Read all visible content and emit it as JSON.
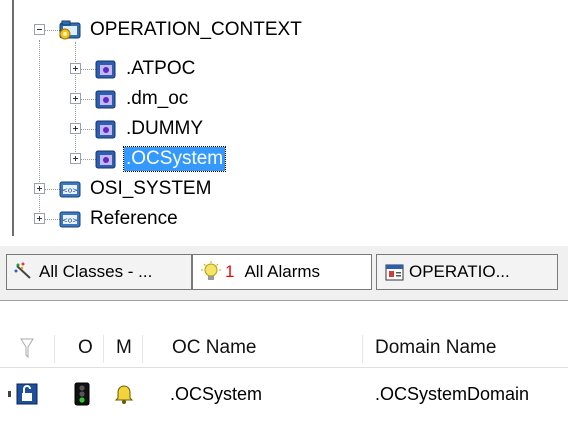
{
  "tree": {
    "root": {
      "label": "OPERATION_CONTEXT",
      "icon": "operation-context-folder-icon"
    },
    "children": [
      {
        "label": ".ATPOC",
        "icon": "domain-node-icon"
      },
      {
        "label": ".dm_oc",
        "icon": "domain-node-icon"
      },
      {
        "label": ".DUMMY",
        "icon": "domain-node-icon"
      },
      {
        "label": ".OCSystem",
        "icon": "domain-node-icon",
        "selected": true
      }
    ],
    "siblings": [
      {
        "label": "OSI_SYSTEM",
        "icon": "class-folder-icon"
      },
      {
        "label": "Reference",
        "icon": "class-folder-icon"
      }
    ]
  },
  "tabs": [
    {
      "label": "All Classes - ...",
      "icon": "all-classes-icon"
    },
    {
      "count": "1",
      "label": "All Alarms",
      "icon": "lightbulb-icon"
    },
    {
      "label": "OPERATIO...",
      "icon": "properties-icon"
    }
  ],
  "grid": {
    "columns": {
      "o": "O",
      "m": "M",
      "oc_name": "OC Name",
      "domain_name": "Domain Name"
    },
    "rows": [
      {
        "oc_name": ".OCSystem",
        "domain_name": ".OCSystemDomain"
      }
    ]
  },
  "colors": {
    "selection": "#3399ff",
    "alarm_count": "#e01010",
    "tab_bg": "#f0f0f0"
  }
}
